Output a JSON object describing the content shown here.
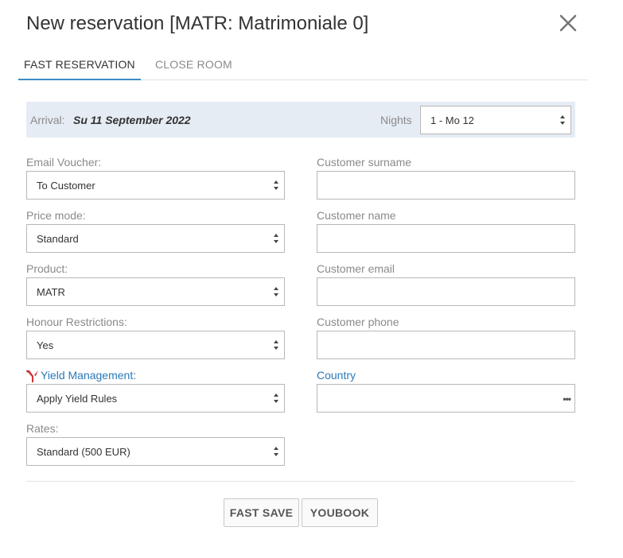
{
  "dialog": {
    "title": "New reservation [MATR: Matrimoniale 0]",
    "close_icon": "close-icon"
  },
  "tabs": [
    {
      "label": "FAST RESERVATION",
      "active": true
    },
    {
      "label": "CLOSE ROOM",
      "active": false
    }
  ],
  "arrival": {
    "label": "Arrival:",
    "value": "Su 11 September 2022",
    "nights_label": "Nights",
    "nights_value": "1 - Mo 12"
  },
  "left_fields": {
    "email_voucher": {
      "label": "Email Voucher:",
      "value": "To Customer"
    },
    "price_mode": {
      "label": "Price mode:",
      "value": "Standard"
    },
    "product": {
      "label": "Product:",
      "value": "MATR"
    },
    "honour_restrictions": {
      "label": "Honour Restrictions:",
      "value": "Yes"
    },
    "yield_management": {
      "label": "Yield Management:",
      "value": "Apply Yield Rules",
      "icon": "yield-logo-icon"
    },
    "rates": {
      "label": "Rates:",
      "value": "Standard (500 EUR)"
    }
  },
  "right_fields": {
    "customer_surname": {
      "label": "Customer surname",
      "value": ""
    },
    "customer_name": {
      "label": "Customer name",
      "value": ""
    },
    "customer_email": {
      "label": "Customer email",
      "value": ""
    },
    "customer_phone": {
      "label": "Customer phone",
      "value": ""
    },
    "country": {
      "label": "Country",
      "value": "",
      "picker_glyph": "•••"
    }
  },
  "buttons": {
    "fast_save": "FAST SAVE",
    "youbook": "YOUBOOK"
  },
  "colors": {
    "accent": "#3c8dc5",
    "link": "#2a79b8",
    "arrival_bg": "#e6ecf4",
    "yield_icon": "#d0343a"
  }
}
